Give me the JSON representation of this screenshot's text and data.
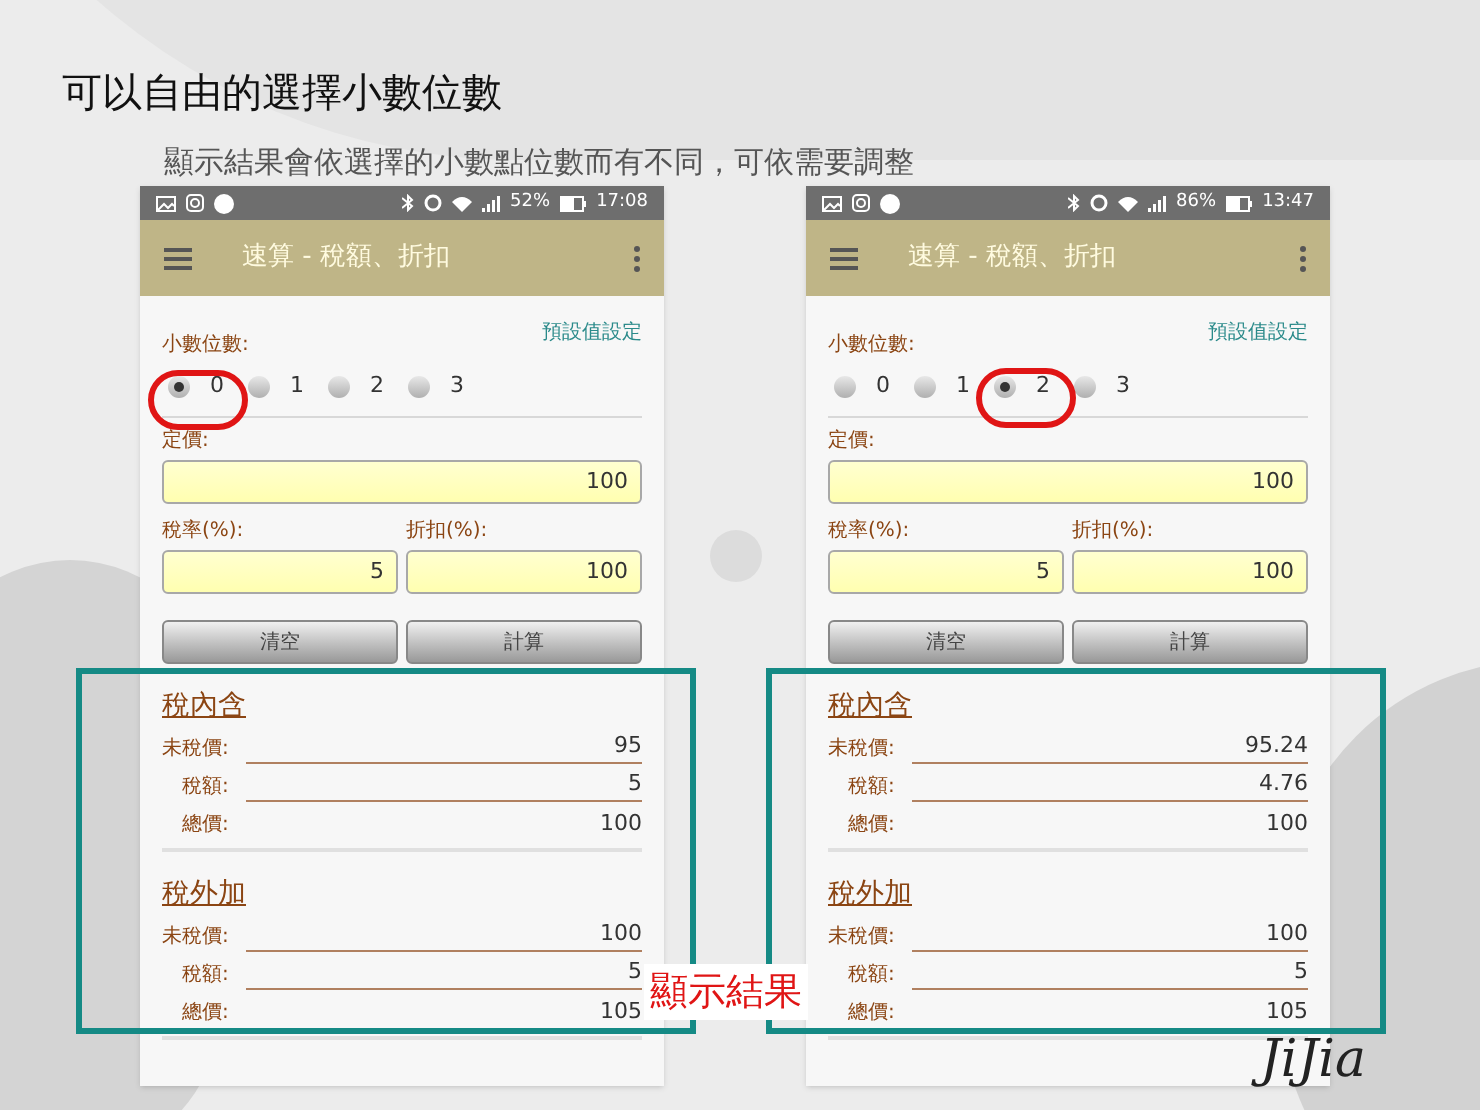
{
  "title": "可以自由的選擇小數位數",
  "subtitle": "顯示結果會依選擇的小數點位數而有不同，可依需要調整",
  "phones": [
    {
      "status_time": "17:08",
      "battery": "52%",
      "app_title": "速算 - 稅額、折扣",
      "defaults_link": "預設值設定",
      "decimal_label": "小數位數:",
      "options": [
        {
          "label": "0",
          "selected": true
        },
        {
          "label": "1",
          "selected": false
        },
        {
          "label": "2",
          "selected": false
        },
        {
          "label": "3",
          "selected": false
        }
      ],
      "price": {
        "label": "定價:",
        "value": "100"
      },
      "tax": {
        "label": "稅率(%):",
        "value": "5"
      },
      "discount": {
        "label": "折扣(%):",
        "value": "100"
      },
      "buttons": [
        "清空",
        "計算"
      ],
      "sections": [
        {
          "title": "稅內含",
          "rows": [
            {
              "label": "未稅價:",
              "value": "95"
            },
            {
              "label": "稅額:",
              "value": "5"
            },
            {
              "label": "總價:",
              "value": "100"
            }
          ]
        },
        {
          "title": "稅外加",
          "rows": [
            {
              "label": "未稅價:",
              "value": "100"
            },
            {
              "label": "稅額:",
              "value": "5"
            },
            {
              "label": "總價:",
              "value": "105"
            }
          ]
        }
      ]
    },
    {
      "status_time": "13:47",
      "battery": "86%",
      "app_title": "速算 - 稅額、折扣",
      "defaults_link": "預設值設定",
      "decimal_label": "小數位數:",
      "options": [
        {
          "label": "0",
          "selected": false
        },
        {
          "label": "1",
          "selected": false
        },
        {
          "label": "2",
          "selected": true
        },
        {
          "label": "3",
          "selected": false
        }
      ],
      "price": {
        "label": "定價:",
        "value": "100"
      },
      "tax": {
        "label": "稅率(%):",
        "value": "5"
      },
      "discount": {
        "label": "折扣(%):",
        "value": "100"
      },
      "buttons": [
        "清空",
        "計算"
      ],
      "sections": [
        {
          "title": "稅內含",
          "rows": [
            {
              "label": "未稅價:",
              "value": "95.24"
            },
            {
              "label": "稅額:",
              "value": "4.76"
            },
            {
              "label": "總價:",
              "value": "100"
            }
          ]
        },
        {
          "title": "稅外加",
          "rows": [
            {
              "label": "未稅價:",
              "value": "100"
            },
            {
              "label": "稅額:",
              "value": "5"
            },
            {
              "label": "總價:",
              "value": "105"
            }
          ]
        }
      ]
    }
  ],
  "callout": "顯示結果",
  "logo": "JiJia"
}
